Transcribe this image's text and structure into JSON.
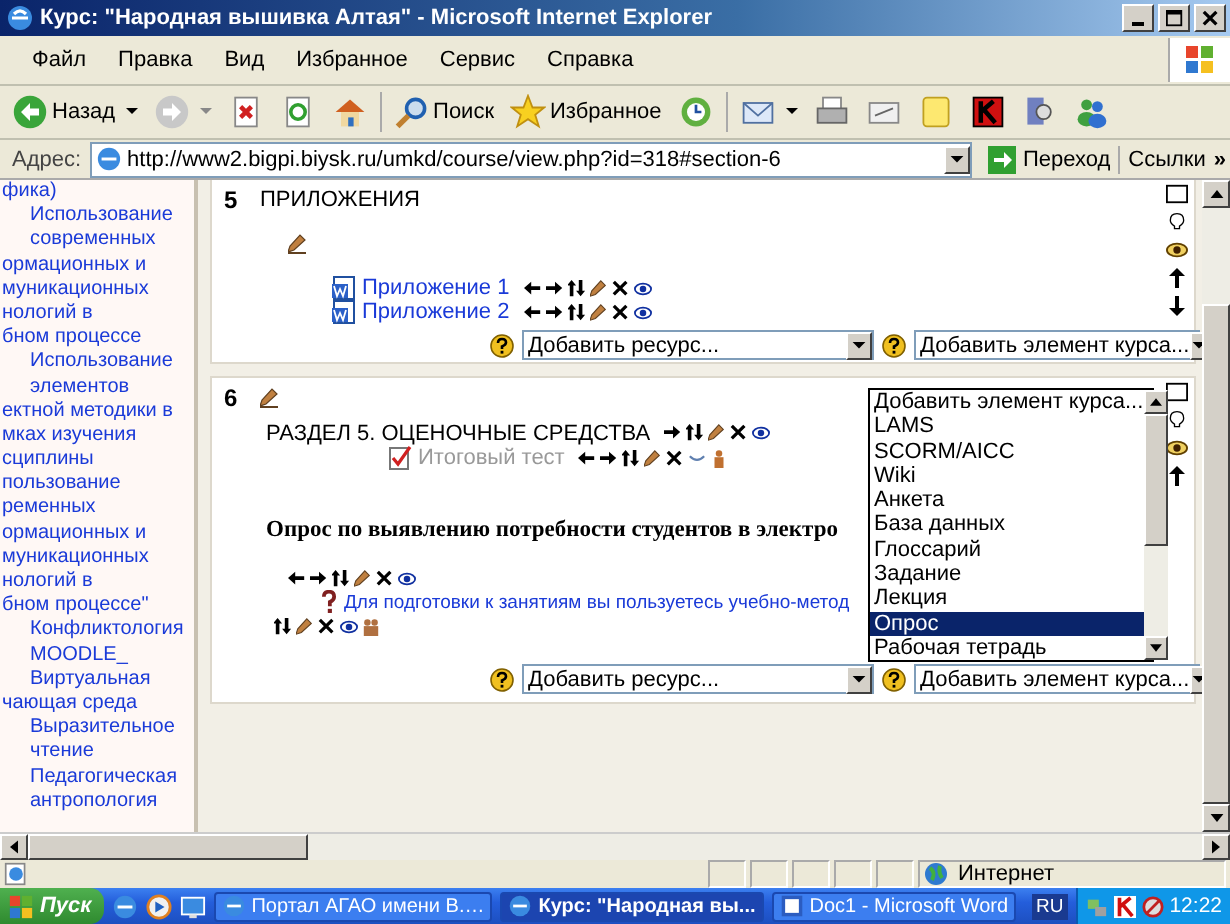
{
  "window": {
    "title": "Курс: \"Народная вышивка Алтая\" - Microsoft Internet Explorer"
  },
  "menu": [
    "Файл",
    "Правка",
    "Вид",
    "Избранное",
    "Сервис",
    "Справка"
  ],
  "toolbar": {
    "back": "Назад",
    "search": "Поиск",
    "favorites": "Избранное"
  },
  "address": {
    "label": "Адрес:",
    "url": "http://www2.bigpi.biysk.ru/umkd/course/view.php?id=318#section-6",
    "go": "Переход",
    "links": "Ссылки",
    "more": "»"
  },
  "sidebar": {
    "lines": [
      {
        "text": "фика)",
        "clipped": true
      },
      {
        "text": "Использование",
        "clipped": false
      },
      {
        "text": "современных",
        "clipped": false
      },
      {
        "text": "ормационных и",
        "clipped": true
      },
      {
        "text": "муникационных",
        "clipped": true
      },
      {
        "text": "нологий в",
        "clipped": true
      },
      {
        "text": "бном процессе",
        "clipped": true
      },
      {
        "text": "Использование",
        "clipped": false
      },
      {
        "text": "элементов",
        "clipped": false
      },
      {
        "text": "ектной методики в",
        "clipped": true
      },
      {
        "text": "мках изучения",
        "clipped": true
      },
      {
        "text": "сциплины",
        "clipped": true
      },
      {
        "text": "пользование",
        "clipped": true
      },
      {
        "text": "ременных",
        "clipped": true
      },
      {
        "text": "ормационных и",
        "clipped": true
      },
      {
        "text": "муникационных",
        "clipped": true
      },
      {
        "text": "нологий в",
        "clipped": true
      },
      {
        "text": "бном процессе\"",
        "clipped": true
      },
      {
        "text": "Конфликтология",
        "clipped": false
      },
      {
        "text": "MOODLE_",
        "clipped": false
      },
      {
        "text": "Виртуальная",
        "clipped": false
      },
      {
        "text": "чающая среда",
        "clipped": true
      },
      {
        "text": "Выразительное",
        "clipped": false
      },
      {
        "text": "чтение",
        "clipped": false
      },
      {
        "text": "Педагогическая",
        "clipped": false
      },
      {
        "text": "антропология",
        "clipped": false
      }
    ]
  },
  "sections": [
    {
      "number": "5",
      "title": "ПРИЛОЖЕНИЯ",
      "items": [
        {
          "kind": "resource",
          "text": "Приложение 1",
          "hidden": false
        },
        {
          "kind": "resource",
          "text": "Приложение 2",
          "hidden": false
        }
      ],
      "add_resource": "Добавить ресурс...",
      "add_activity": "Добавить элемент курса..."
    },
    {
      "number": "6",
      "items": [
        {
          "kind": "heading",
          "text": "РАЗДЕЛ 5. ОЦЕНОЧНЫЕ СРЕДСТВА",
          "hidden": false
        },
        {
          "kind": "quiz",
          "text": "Итоговый тест",
          "hidden": true
        },
        {
          "kind": "label",
          "text": "Опрос по выявлению потребности студентов в электро",
          "hidden": false
        },
        {
          "kind": "choice",
          "text": "Для подготовки к занятиям вы пользуетесь учебно-метод",
          "hidden": false
        }
      ],
      "add_resource": "Добавить ресурс...",
      "add_activity": "Добавить элемент курса..."
    }
  ],
  "dropdown": {
    "options": [
      {
        "label": "Добавить элемент курса...",
        "selected": false
      },
      {
        "label": "LAMS",
        "selected": false
      },
      {
        "label": "SCORM/AICC",
        "selected": false
      },
      {
        "label": "Wiki",
        "selected": false
      },
      {
        "label": "Анкета",
        "selected": false
      },
      {
        "label": "База данных",
        "selected": false
      },
      {
        "label": "Глоссарий",
        "selected": false
      },
      {
        "label": "Задание",
        "selected": false
      },
      {
        "label": "Лекция",
        "selected": false
      },
      {
        "label": "Опрос",
        "selected": true
      },
      {
        "label": "Рабочая тетрадь",
        "selected": false
      }
    ]
  },
  "status_bar": {
    "zone": "Интернет"
  },
  "taskbar": {
    "start": "Пуск",
    "tasks": [
      {
        "label": "Портал АГАО имени В.…",
        "selected": false
      },
      {
        "label": "Курс: \"Народная вы...",
        "selected": true
      },
      {
        "label": "Doc1 - Microsoft Word",
        "selected": false
      }
    ],
    "lang": "RU",
    "clock": "12:22"
  }
}
